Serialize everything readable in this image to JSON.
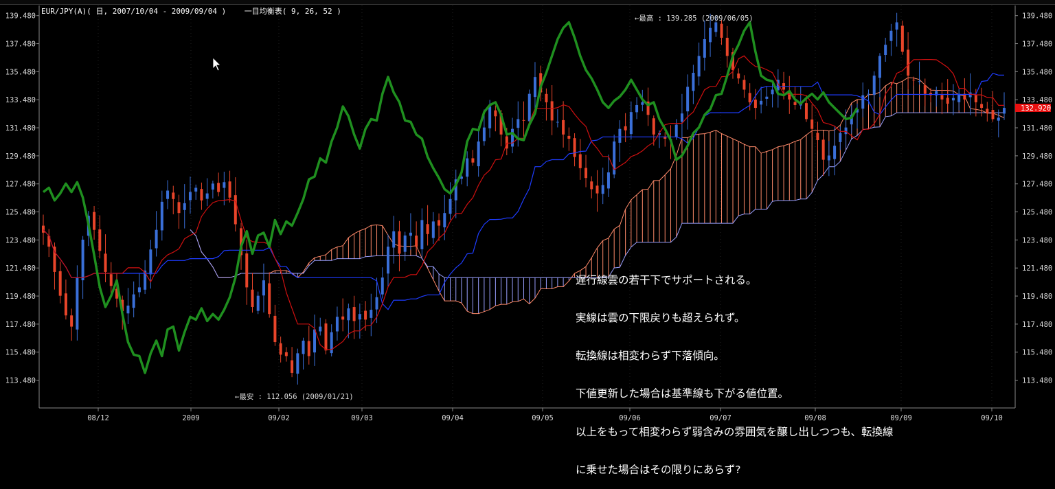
{
  "header": {
    "symbol": "EUR/JPY(A)",
    "period_text": "EUR/JPY(A)( 日, 2007/10/04 - 2009/09/04 )",
    "indicator_text": "一目均衡表( 9, 26, 52 )"
  },
  "annotations": {
    "high": "←最高 : 139.285 (2009/06/05)",
    "low": "←最安 : 112.056 (2009/01/21)"
  },
  "current_price": "132.920",
  "memo_lines": [
    "遅行線雲の若干下でサポートされる。",
    "実線は雲の下限戻りも超えられず。",
    "転換線は相変わらず下落傾向。",
    "下値更新した場合は基準線も下がる値位置。",
    "以上をもって相変わらず弱含みの雰囲気を醸し出しつつも、転換線",
    "に乗せた場合はその限りにあらず?"
  ],
  "colors": {
    "background": "#000000",
    "grid": "#3a3a3a",
    "up_candle": "#3a6fd8",
    "down_candle": "#e8452a",
    "tenkan": "#d01010",
    "kijun": "#1e3cff",
    "chikou": "#1f8f1f",
    "cloud_bear": "#9aa0ff",
    "cloud_bull": "#ff8a6a",
    "price_tag": "#e81010"
  },
  "chart_data": {
    "type": "candlestick-ichimoku",
    "y_ticks": [
      "139.480",
      "137.480",
      "135.480",
      "133.480",
      "131.480",
      "129.480",
      "127.480",
      "125.480",
      "123.480",
      "121.480",
      "119.480",
      "117.480",
      "115.480",
      "113.480"
    ],
    "x_ticks": [
      "08/12",
      "2009",
      "09/02",
      "09/03",
      "09/04",
      "09/05",
      "09/06",
      "09/07",
      "09/08",
      "09/09",
      "09/10"
    ],
    "ylim": [
      111.5,
      140.2
    ],
    "close_series": [
      124.0,
      123.0,
      121.2,
      119.5,
      118.1,
      117.3,
      120.8,
      123.5,
      125.2,
      124.2,
      122.7,
      121.2,
      120.2,
      119.3,
      118.4,
      118.8,
      119.6,
      120.1,
      121.3,
      122.8,
      124.2,
      126.2,
      127.0,
      126.4,
      125.4,
      126.1,
      126.9,
      127.2,
      126.3,
      126.8,
      127.5,
      126.9,
      127.6,
      126.5,
      124.6,
      122.4,
      120.1,
      118.7,
      119.5,
      120.6,
      118.2,
      116.2,
      115.3,
      115.2,
      114.0,
      115.4,
      116.3,
      115.2,
      117.1,
      117.3,
      115.6,
      116.9,
      118.0,
      117.8,
      118.6,
      117.7,
      118.2,
      117.8,
      118.5,
      119.4,
      120.8,
      123.0,
      124.1,
      122.5,
      123.8,
      124.0,
      123.0,
      124.9,
      123.9,
      124.8,
      124.5,
      125.4,
      126.4,
      127.8,
      128.0,
      129.3,
      129.0,
      130.5,
      131.5,
      133.0,
      132.3,
      131.0,
      130.0,
      131.4,
      132.1,
      132.0,
      133.9,
      135.1,
      134.0,
      133.3,
      132.0,
      131.9,
      131.0,
      130.7,
      129.4,
      128.6,
      127.9,
      127.1,
      126.8,
      127.4,
      128.3,
      130.5,
      131.4,
      131.3,
      132.6,
      133.1,
      133.3,
      132.4,
      131.0,
      131.1,
      130.7,
      130.6,
      131.7,
      132.5,
      134.4,
      135.4,
      136.6,
      137.8,
      138.6,
      139.0,
      137.9,
      136.6,
      135.6,
      135.0,
      134.2,
      133.3,
      132.9,
      133.4,
      133.7,
      134.2,
      134.9,
      134.2,
      133.5,
      133.1,
      133.3,
      132.1,
      131.4,
      130.6,
      129.2,
      129.5,
      130.2,
      131.1,
      131.5,
      132.4,
      132.8,
      133.8,
      133.9,
      135.2,
      136.6,
      137.4,
      138.4,
      139.0,
      136.9,
      135.2,
      134.9,
      134.8,
      133.9,
      133.8,
      134.1,
      133.5,
      133.2,
      133.6,
      133.9,
      133.5,
      134.0,
      133.3,
      132.9,
      132.5,
      132.1,
      132.2,
      132.9
    ]
  }
}
